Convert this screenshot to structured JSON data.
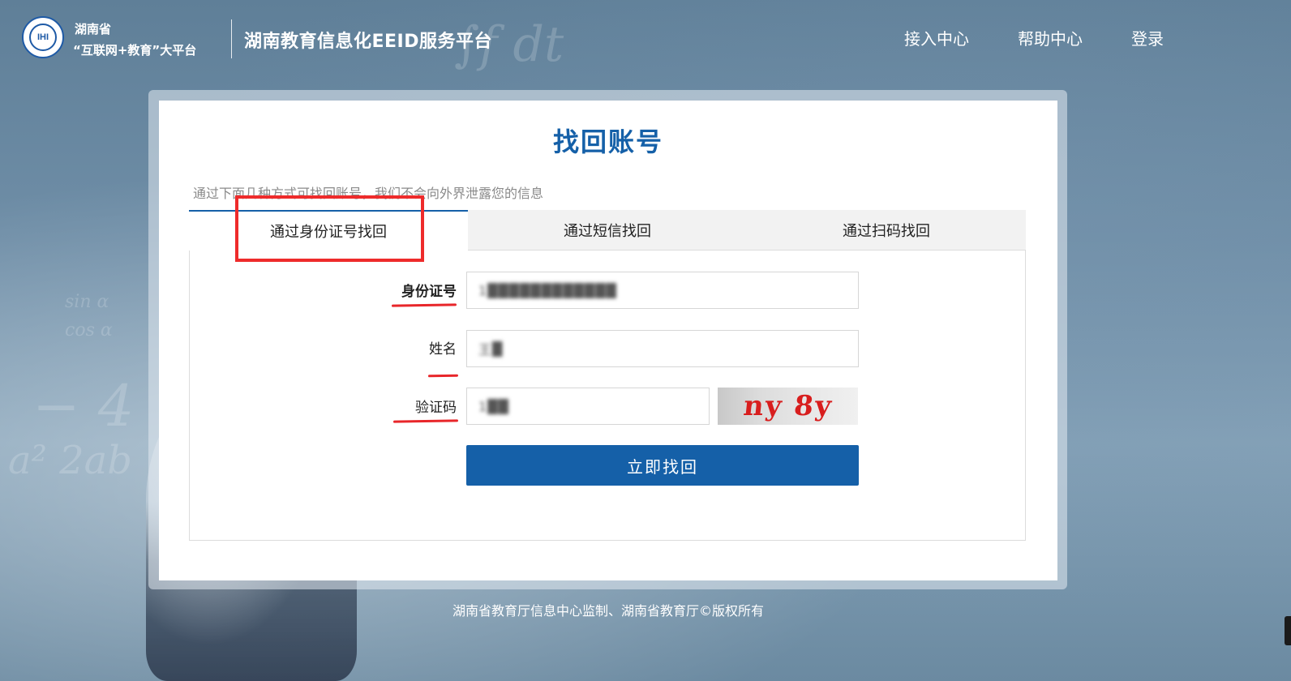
{
  "header": {
    "logo_icon": "hunan-education-seal-icon",
    "brand_line1": "湖南省",
    "brand_line2": "“互联网+教育”大平台",
    "site_title": "湖南教育信息化EEID服务平台",
    "nav": [
      {
        "label": "接入中心"
      },
      {
        "label": "帮助中心"
      },
      {
        "label": "登录"
      }
    ]
  },
  "card": {
    "title": "找回账号",
    "subtitle": "通过下面几种方式可找回账号，我们不会向外界泄露您的信息",
    "tabs": [
      {
        "label": "通过身份证号找回",
        "active": true
      },
      {
        "label": "通过短信找回",
        "active": false
      },
      {
        "label": "通过扫码找回",
        "active": false
      }
    ],
    "form": {
      "id_label": "身份证号",
      "id_value": "1",
      "name_label": "姓名",
      "name_value": "王",
      "captcha_label": "验证码",
      "captcha_value": "1",
      "captcha_image_text": "ny 8y",
      "submit_label": "立即找回"
    }
  },
  "footer": {
    "text": "湖南省教育厅信息中心监制、湖南省教育厅©版权所有"
  },
  "colors": {
    "accent": "#1560a8",
    "annotation_red": "#ee2b2b"
  }
}
